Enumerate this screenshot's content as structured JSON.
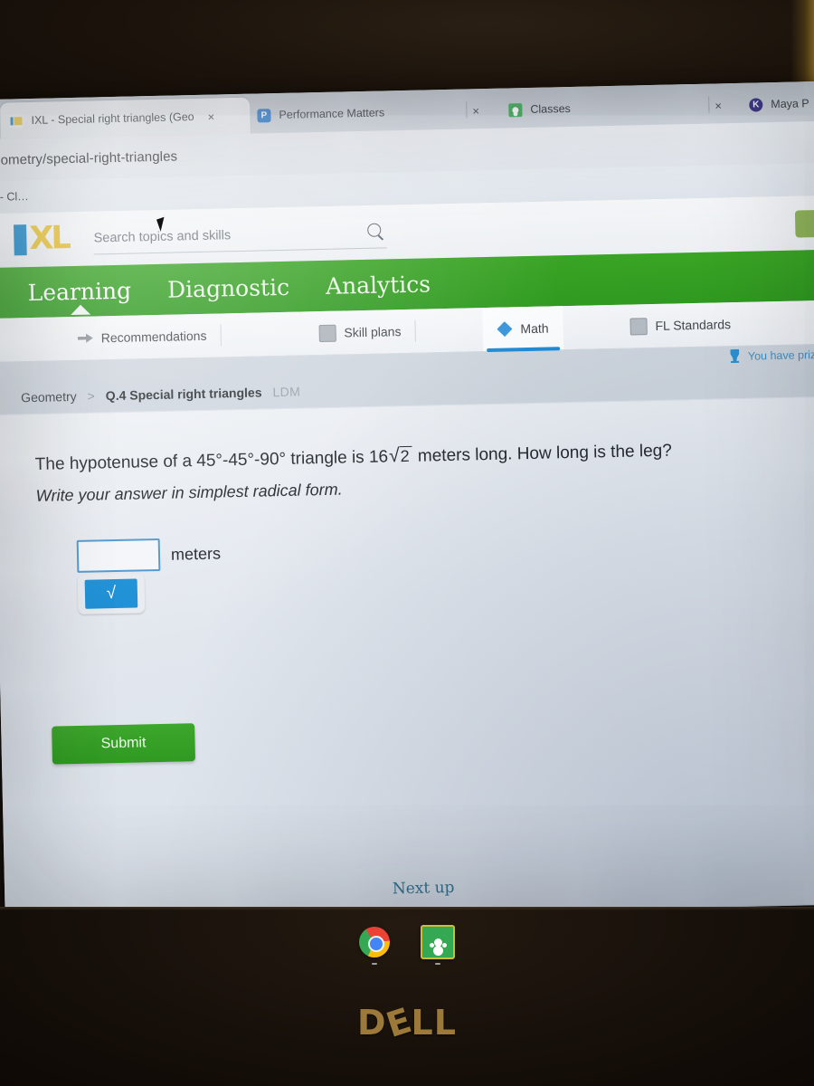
{
  "device": {
    "brand": "DELL"
  },
  "browser": {
    "tabs": [
      {
        "title": "IXL - Special right triangles (Geo",
        "icon": "ixl-favicon",
        "active": true,
        "close": "×"
      },
      {
        "title": "Performance Matters",
        "icon": "performance-matters-favicon",
        "active": false,
        "close": "×"
      },
      {
        "title": "Classes",
        "icon": "google-classroom-favicon",
        "active": false,
        "close": "×"
      },
      {
        "title": "Maya P",
        "icon": "kahoot-favicon",
        "active": false,
        "close": "×"
      }
    ],
    "address_bar": {
      "value": "/geometry/special-right-triangles"
    },
    "bookmarks": [
      {
        "label": "ua - Cl…"
      }
    ]
  },
  "ixl": {
    "logo": {
      "i": "I",
      "xl": "XL"
    },
    "search": {
      "placeholder": "Search topics and skills",
      "icon": "search-icon"
    },
    "nav": [
      {
        "label": "Learning",
        "active": true
      },
      {
        "label": "Diagnostic",
        "active": false
      },
      {
        "label": "Analytics",
        "active": false
      }
    ],
    "subnav": [
      {
        "label": "Recommendations",
        "icon": "recommendations-icon",
        "active": false
      },
      {
        "label": "Skill plans",
        "icon": "skill-plans-icon",
        "active": false
      },
      {
        "label": "Math",
        "icon": "math-icon",
        "active": true
      },
      {
        "label": "FL Standards",
        "icon": "standards-icon",
        "active": false
      }
    ],
    "prizes": {
      "text": "You have prizes t",
      "icon": "trophy-icon"
    },
    "breadcrumb": {
      "subject": "Geometry",
      "separator": ">",
      "skill": "Q.4 Special right triangles",
      "code": "LDM"
    }
  },
  "question": {
    "prompt_part1": "The hypotenuse of a 45°-45°-90° triangle is 16",
    "radical_sign": "√",
    "radicand": "2",
    "prompt_part2": "meters long. How long is the leg?",
    "instruction": "Write your answer in simplest radical form.",
    "answer_value": "",
    "answer_placeholder": "",
    "unit_label": "meters",
    "keypad_button": "√",
    "submit_label": "Submit",
    "next_up_label": "Next up",
    "colors": {
      "accent_green": "#2f9a1f",
      "accent_blue": "#1b8fd6",
      "input_border": "#4e97cf"
    }
  },
  "shelf": {
    "icons": [
      {
        "name": "chrome-icon",
        "label": "Chrome"
      },
      {
        "name": "google-classroom-icon",
        "label": "Classroom"
      }
    ]
  }
}
